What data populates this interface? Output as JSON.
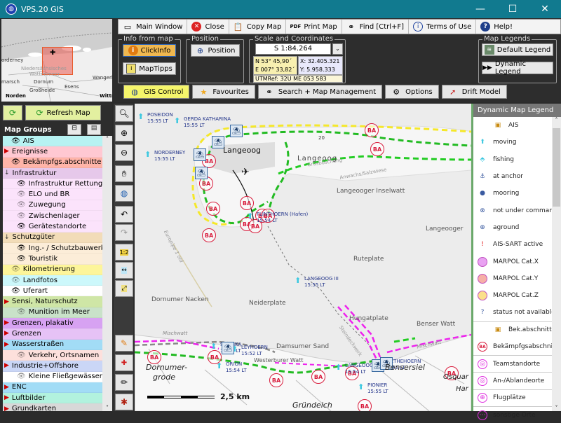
{
  "window": {
    "title": "VPS.20  GIS",
    "minimize": "—",
    "maximize": "☐",
    "close": "✕"
  },
  "toolbar": {
    "items": [
      {
        "label": "Main Window",
        "icon": "window-icon"
      },
      {
        "label": "Close",
        "icon": "close-circle-icon"
      },
      {
        "label": "Copy Map",
        "icon": "clipboard-icon"
      },
      {
        "label": "Print Map",
        "icon": "pdf-icon"
      },
      {
        "label": "Find [Ctrl+F]",
        "icon": "binoculars-icon"
      },
      {
        "label": "Terms of Use",
        "icon": "info-icon"
      },
      {
        "label": "Help!",
        "icon": "help-icon"
      }
    ]
  },
  "info_from_map": {
    "title": "Info from map",
    "clickinfo": "ClickInfo",
    "maptipps": "MapTipps"
  },
  "position": {
    "title": "Position",
    "button": "Position"
  },
  "scale_coords": {
    "title": "Scale and Coordinates",
    "scale": "S 1:84.264",
    "lat": "N 53° 45,90´",
    "lon": "E 007° 33,82´",
    "x": "X: 32.405.321",
    "y": "Y: 5.958.333",
    "utm": "UTMRef: 32U ME 053 583"
  },
  "map_legends": {
    "title": "Map Legends",
    "default": "Default Legend",
    "dynamic": "Dynamic Legend"
  },
  "tabs": [
    {
      "label": "GIS Control",
      "active": true
    },
    {
      "label": "Favourites"
    },
    {
      "label": "Search + Map Management"
    },
    {
      "label": "Options"
    },
    {
      "label": "Drift Model"
    }
  ],
  "sidebar": {
    "refresh": "Refresh Map",
    "map_groups": "Map Groups",
    "items": [
      {
        "label": "AIS",
        "type": "eye",
        "bg": "#b7f2f2",
        "indent": 1
      },
      {
        "label": "Ereignisse",
        "type": "collapsed",
        "bg": "#ffc8d2",
        "indent": 0
      },
      {
        "label": "Bekämpfgs.abschnitte",
        "type": "eye",
        "bg": "#ffb4a8",
        "indent": 1
      },
      {
        "label": "Infrastruktur",
        "type": "expanded",
        "bg": "#e6c8ea",
        "indent": 0
      },
      {
        "label": "Infrastruktur Rettung",
        "type": "eye",
        "bg": "#fbe3fb",
        "indent": 2
      },
      {
        "label": "ELO und BR",
        "type": "hidden",
        "bg": "#fbe3fb",
        "indent": 2
      },
      {
        "label": "Zuwegung",
        "type": "hidden",
        "bg": "#fbe3fb",
        "indent": 2
      },
      {
        "label": "Zwischenlager",
        "type": "hidden",
        "bg": "#fbe3fb",
        "indent": 2
      },
      {
        "label": "Gerätestandorte",
        "type": "eye",
        "bg": "#fbe3fb",
        "indent": 2
      },
      {
        "label": "Schutzgüter",
        "type": "expanded",
        "bg": "#f2dcb8",
        "indent": 0
      },
      {
        "label": "Ing.- / Schutzbauwerke",
        "type": "eye",
        "bg": "#fcedd8",
        "indent": 2
      },
      {
        "label": "Touristik",
        "type": "eye",
        "bg": "#fcedd8",
        "indent": 2
      },
      {
        "label": "Kilometrierung",
        "type": "hidden",
        "bg": "#fdf59a",
        "indent": 1
      },
      {
        "label": "Landfotos",
        "type": "hidden",
        "bg": "#ccf8fb",
        "indent": 1
      },
      {
        "label": "Uferart",
        "type": "eye",
        "bg": "#ffffff",
        "indent": 1
      },
      {
        "label": "Sensi, Naturschutz",
        "type": "collapsed",
        "bg": "#cfe6a6",
        "indent": 0
      },
      {
        "label": "Munition im Meer",
        "type": "hidden",
        "bg": "#c9e2c9",
        "indent": 2
      },
      {
        "label": "Grenzen, plakativ",
        "type": "collapsed",
        "bg": "#d7a2f2",
        "indent": 0
      },
      {
        "label": "Grenzen",
        "type": "collapsed",
        "bg": "#e6c2f6",
        "indent": 0
      },
      {
        "label": "Wasserstraßen",
        "type": "collapsed",
        "bg": "#a2dcf6",
        "indent": 0
      },
      {
        "label": "Verkehr, Ortsnamen",
        "type": "hidden",
        "bg": "#fde0dc",
        "indent": 2
      },
      {
        "label": "Industrie+Offshore",
        "type": "collapsed",
        "bg": "#cad6f6",
        "indent": 0
      },
      {
        "label": "Kleine Fließgewässer",
        "type": "hidden",
        "bg": "#ffffff",
        "indent": 2
      },
      {
        "label": "ENC",
        "type": "collapsed",
        "bg": "#a2dcf6",
        "indent": 0
      },
      {
        "label": "Luftbilder",
        "type": "collapsed",
        "bg": "#b2f2de",
        "indent": 0
      },
      {
        "label": "Grundkarten",
        "type": "collapsed",
        "bg": "#d8d8d8",
        "indent": 0
      }
    ]
  },
  "overview": {
    "labels": [
      "orderney",
      "Niedersächsisches",
      "Wattenmeer",
      "Dornum",
      "Esens",
      "Wangerl.",
      "marsch",
      "Großheide",
      "Norden",
      "Wittm"
    ]
  },
  "map": {
    "labels": [
      {
        "text": "Langeoog",
        "kind": "town"
      },
      {
        "text": "Langeoog",
        "kind": "town2"
      },
      {
        "text": "Langeooger Inselwatt",
        "kind": "area"
      },
      {
        "text": "Langeooger",
        "kind": "area"
      },
      {
        "text": "Ruteplate",
        "kind": "area"
      },
      {
        "text": "Dornumer Nacken",
        "kind": "area"
      },
      {
        "text": "Neiderplate",
        "kind": "area"
      },
      {
        "text": "Hungatplate",
        "kind": "area"
      },
      {
        "text": "Benser Watt",
        "kind": "area"
      },
      {
        "text": "Damsumer Sand",
        "kind": "area"
      },
      {
        "text": "Westerburer Watt",
        "kind": "area"
      },
      {
        "text": "Dornumer-",
        "kind": "town"
      },
      {
        "text": "grode",
        "kind": "town"
      },
      {
        "text": "Gründeich",
        "kind": "town"
      },
      {
        "text": "Bensersiel",
        "kind": "town"
      },
      {
        "text": "Osquar",
        "kind": "town"
      },
      {
        "text": "Har",
        "kind": "town"
      },
      {
        "text": "Anwachs/Salzwiese",
        "kind": "small"
      },
      {
        "text": "Grasböschung",
        "kind": "small"
      },
      {
        "text": "Mischwatt",
        "kind": "small"
      },
      {
        "text": "Mischwatt",
        "kind": "small"
      },
      {
        "text": "Europipe 1 old",
        "kind": "small"
      },
      {
        "text": "Steindeckwerk",
        "kind": "small"
      },
      {
        "text": "20",
        "kind": "small"
      },
      {
        "text": "12",
        "kind": "small"
      }
    ],
    "ships": [
      {
        "name": "POSEIDON",
        "time": "15:55 LT"
      },
      {
        "name": "GERDA KATHARINA",
        "time": "15:55 LT"
      },
      {
        "name": "NORDERNEY",
        "time": "15:55 LT"
      },
      {
        "name": "FLINTHOERN (Hafen)",
        "time": "15:54 LT"
      },
      {
        "name": "LANGEOOG III",
        "time": "15:55 LT"
      },
      {
        "name": "SVEDIKA",
        "time": "15:49 LT"
      },
      {
        "name": "LEYHOERN",
        "time": "15:52 LT"
      },
      {
        "name": "ORION",
        "time": "15:54 LT"
      },
      {
        "name": "LANGEOOG",
        "time": "15:54 LT"
      },
      {
        "name": "LUETHEHOERN",
        "time": "15:55 LT"
      },
      {
        "name": "PIONIER",
        "time": "15:55 LT"
      }
    ],
    "ba_marker": "BA",
    "scalebar": "2,5 km"
  },
  "legend": {
    "title": "Dynamic Map Legend",
    "items": [
      {
        "label": "AIS",
        "icon": "ais-group-icon"
      },
      {
        "label": "moving",
        "icon": "ship-moving-icon"
      },
      {
        "label": "fishing",
        "icon": "ship-fishing-icon"
      },
      {
        "label": "at anchor",
        "icon": "anchor-icon"
      },
      {
        "label": "mooring",
        "icon": "mooring-icon"
      },
      {
        "label": "not under command",
        "icon": "not-under-command-icon"
      },
      {
        "label": "aground",
        "icon": "aground-icon"
      },
      {
        "label": "AIS-SART active",
        "icon": "sart-icon"
      },
      {
        "label": "MARPOL Cat.X",
        "icon": "marpol-x-icon",
        "color": "#e9a2f2"
      },
      {
        "label": "MARPOL Cat.Y",
        "icon": "marpol-y-icon",
        "color": "#f6b0a6"
      },
      {
        "label": "MARPOL Cat.Z",
        "icon": "marpol-z-icon",
        "color": "#fbe08a"
      },
      {
        "label": "status not available",
        "icon": "status-unknown-icon"
      },
      {
        "label": "Bek.abschnitt M",
        "icon": "group-icon"
      },
      {
        "label": "Bekämpfgsabschnitt",
        "icon": "ba-icon"
      },
      {
        "label": "Teamstandorte",
        "icon": "team-icon"
      },
      {
        "label": "An-/Ablandeorte",
        "icon": "landing-icon"
      },
      {
        "label": "Flugplätze",
        "icon": "airfield-icon"
      },
      {
        "label": "sonstige Orte",
        "icon": "other-places-icon"
      }
    ]
  },
  "colors": {
    "titlebar": "#117a8f",
    "accent_yellow": "#f5f56b",
    "clickinfo": "#f0b850",
    "ba_red": "#d81c3c",
    "green_line": "#22cc22",
    "yellow_line": "#f5e82a",
    "magenta_line": "#ee22ee"
  }
}
